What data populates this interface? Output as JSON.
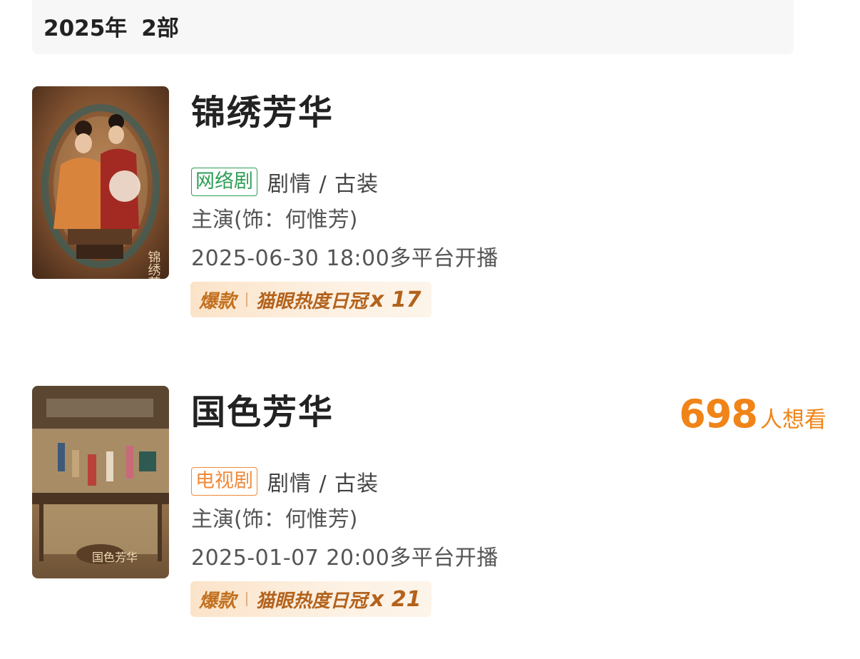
{
  "header": {
    "year": "2025年",
    "count": "2部"
  },
  "items": [
    {
      "title": "锦绣芳华",
      "type_tag": "网络剧",
      "type_color": "#2e9e56",
      "genre": "剧情 / 古装",
      "cast": "主演(饰：何惟芳)",
      "release": "2025-06-30 18:00多平台开播",
      "badge_label": "爆款",
      "badge_rank": "猫眼热度日冠",
      "badge_count": "x 17",
      "poster_text": "锦绣芳华"
    },
    {
      "title": "国色芳华",
      "type_tag": "电视剧",
      "type_color": "#f08a3a",
      "genre": "剧情 / 古装",
      "cast": "主演(饰：何惟芳)",
      "release": "2025-01-07 20:00多平台开播",
      "badge_label": "爆款",
      "badge_rank": "猫眼热度日冠",
      "badge_count": "x 21",
      "want_num": "698",
      "want_label": "人想看",
      "poster_text": "国色芳华"
    }
  ],
  "colors": {
    "accent_orange": "#f08418",
    "badge_text": "#b3621c",
    "web_tag": "#2e9e56",
    "tv_tag": "#f08a3a"
  }
}
